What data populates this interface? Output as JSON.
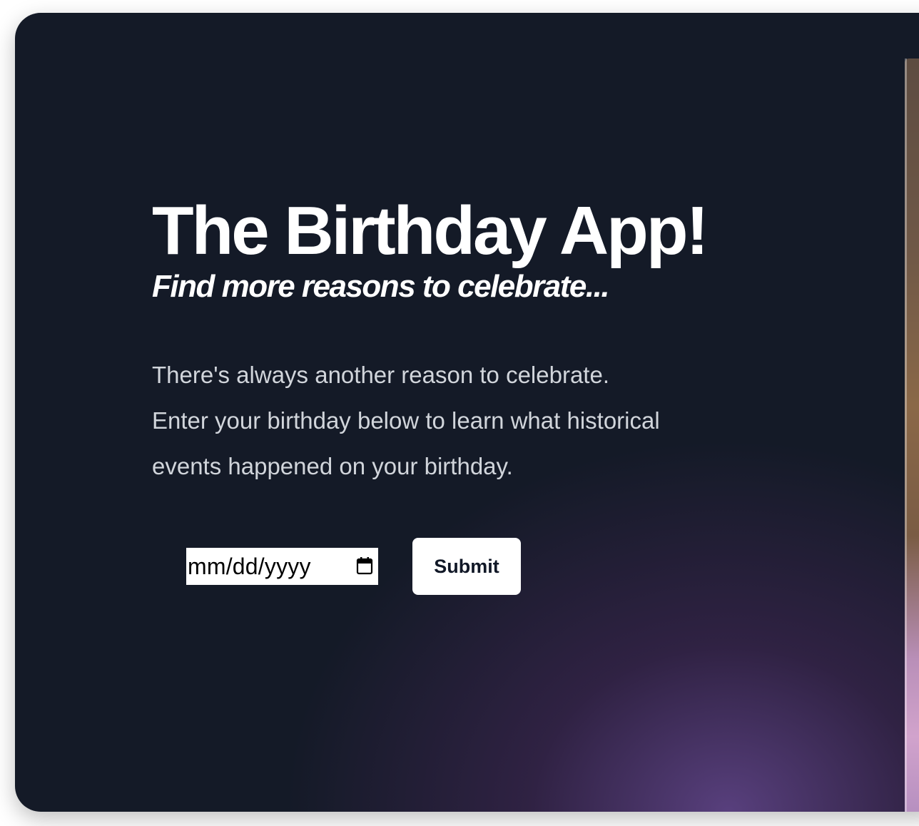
{
  "hero": {
    "title": "The Birthday App!",
    "subtitle": "Find more reasons to celebrate...",
    "description_lines": [
      "There's always another reason to celebrate.",
      "Enter your birthday below to learn what historical",
      "events happened on your birthday."
    ]
  },
  "form": {
    "date_placeholder": "mm/dd/yyyy",
    "date_value": "",
    "submit_label": "Submit"
  },
  "colors": {
    "background": "#141a27",
    "accent_glow": "#4b3468",
    "text_primary": "#ffffff",
    "text_secondary": "#d1d5db",
    "button_bg": "#ffffff",
    "button_text": "#111827"
  },
  "icons": {
    "calendar": "calendar-icon"
  }
}
